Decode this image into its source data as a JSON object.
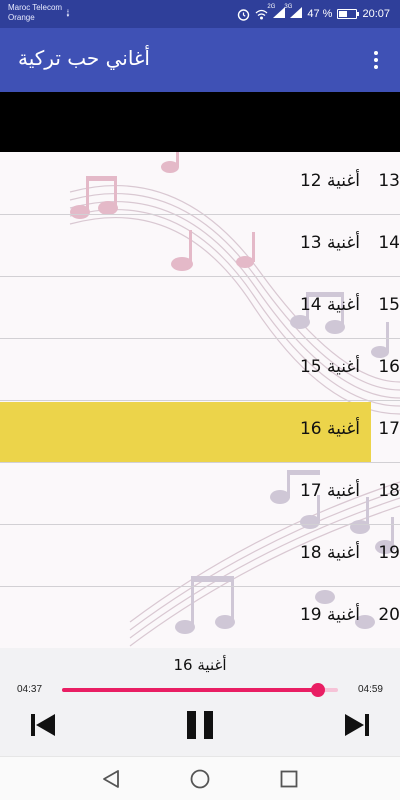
{
  "status_bar": {
    "carrier_line1": "Maroc Telecom",
    "carrier_line2": "Orange",
    "network_1": "2G",
    "network_2": "3G",
    "battery_percent_text": "47 %",
    "battery_level": 0.47,
    "time": "20:07",
    "icons": [
      "usb-icon",
      "alarm-icon",
      "wifi-calling-icon",
      "signal-icon",
      "battery-icon"
    ]
  },
  "app_bar": {
    "title": "أغاني حب تركية",
    "menu_icon": "overflow-menu-icon"
  },
  "songs": [
    {
      "number": "13",
      "title": "أغنية 12"
    },
    {
      "number": "14",
      "title": "أغنية 13"
    },
    {
      "number": "15",
      "title": "أغنية 14"
    },
    {
      "number": "16",
      "title": "أغنية 15"
    },
    {
      "number": "17",
      "title": "أغنية 16",
      "selected": true
    },
    {
      "number": "18",
      "title": "أغنية 17"
    },
    {
      "number": "19",
      "title": "أغنية 18"
    },
    {
      "number": "20",
      "title": "أغنية 19"
    }
  ],
  "player": {
    "now_playing": "أغنية 16",
    "elapsed": "04:37",
    "total": "04:59",
    "progress_fraction": 0.926,
    "controls": [
      "skip-previous-icon",
      "pause-icon",
      "skip-next-icon"
    ],
    "accent_color": "#e91e63",
    "track_color": "#f6c3d7"
  },
  "nav_bar": {
    "icons": [
      "back-triangle-icon",
      "home-circle-icon",
      "recents-square-icon"
    ]
  },
  "colors": {
    "status_bar": "#2f3f9a",
    "app_bar": "#3f51b5",
    "selected_row": "#ecd44a"
  }
}
